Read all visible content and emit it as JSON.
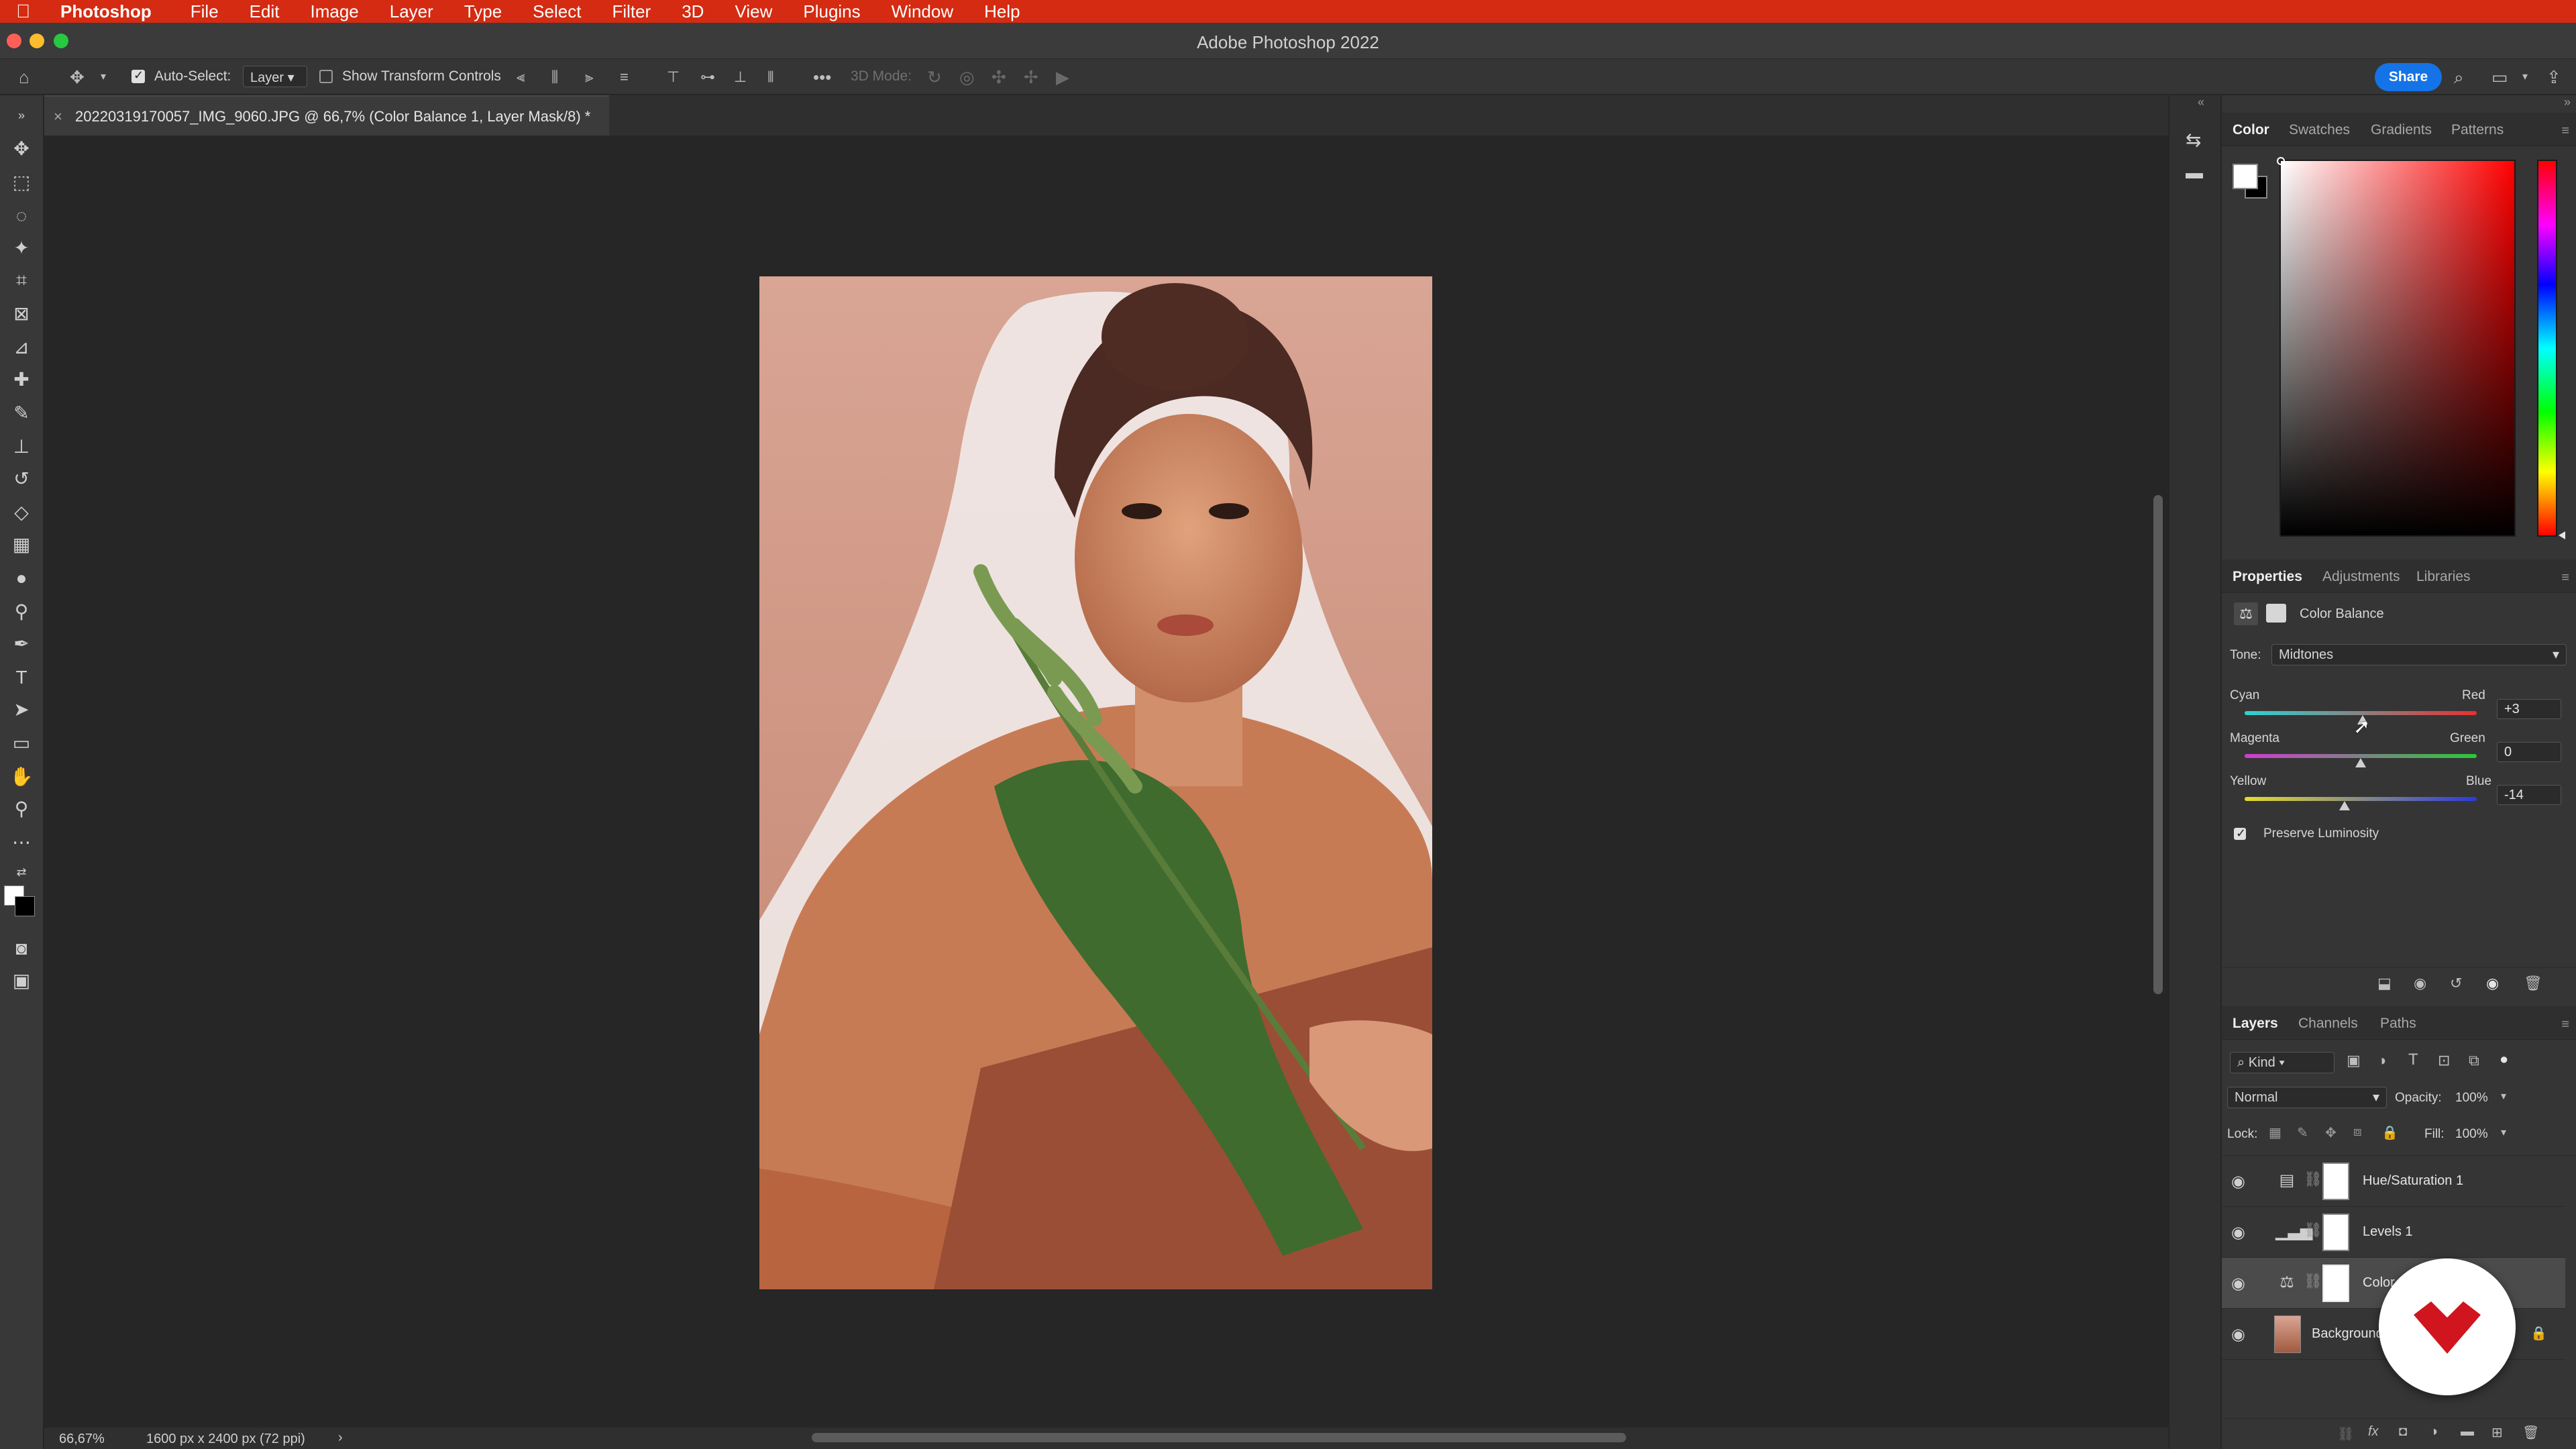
{
  "menubar": {
    "app": "Photoshop",
    "items": [
      "File",
      "Edit",
      "Image",
      "Layer",
      "Type",
      "Select",
      "Filter",
      "3D",
      "View",
      "Plugins",
      "Window",
      "Help"
    ]
  },
  "window": {
    "title": "Adobe Photoshop 2022"
  },
  "options": {
    "auto_select_label": "Auto-Select:",
    "auto_select_checked": true,
    "auto_select_target": "Layer",
    "transform_label": "Show Transform Controls",
    "mode_3d_label": "3D Mode:",
    "share_label": "Share"
  },
  "document": {
    "tab_title": "20220319170057_IMG_9060.JPG @ 66,7% (Color Balance 1, Layer Mask/8) *",
    "zoom": "66,67%",
    "info": "1600 px x 2400 px (72 ppi)"
  },
  "color_panel": {
    "tabs": [
      "Color",
      "Swatches",
      "Gradients",
      "Patterns"
    ],
    "foreground": "#ffffff",
    "background": "#000000",
    "hue_color": "#ff0000"
  },
  "properties": {
    "tabs": [
      "Properties",
      "Adjustments",
      "Libraries"
    ],
    "title": "Color Balance",
    "tone_label": "Tone:",
    "tone_value": "Midtones",
    "sliders": [
      {
        "left": "Cyan",
        "right": "Red",
        "value": "+3",
        "position": 0.51
      },
      {
        "left": "Magenta",
        "right": "Green",
        "value": "0",
        "position": 0.5
      },
      {
        "left": "Yellow",
        "right": "Blue",
        "value": "-14",
        "position": 0.43
      }
    ],
    "preserve_label": "Preserve Luminosity",
    "preserve_checked": true
  },
  "layers_panel": {
    "tabs": [
      "Layers",
      "Channels",
      "Paths"
    ],
    "filter_label": "Kind",
    "blend_mode": "Normal",
    "opacity_label": "Opacity:",
    "opacity_value": "100%",
    "lock_label": "Lock:",
    "fill_label": "Fill:",
    "fill_value": "100%",
    "layers": [
      {
        "name": "Hue/Saturation 1",
        "icon": "hue-saturation-icon",
        "selected": false
      },
      {
        "name": "Levels 1",
        "icon": "levels-icon",
        "selected": false
      },
      {
        "name": "Color Balance 1",
        "icon": "color-balance-icon",
        "selected": true
      },
      {
        "name": "Background",
        "icon": "image-thumbnail",
        "selected": false,
        "locked": true
      }
    ]
  },
  "badge": {
    "brand_color": "#d0151e"
  }
}
